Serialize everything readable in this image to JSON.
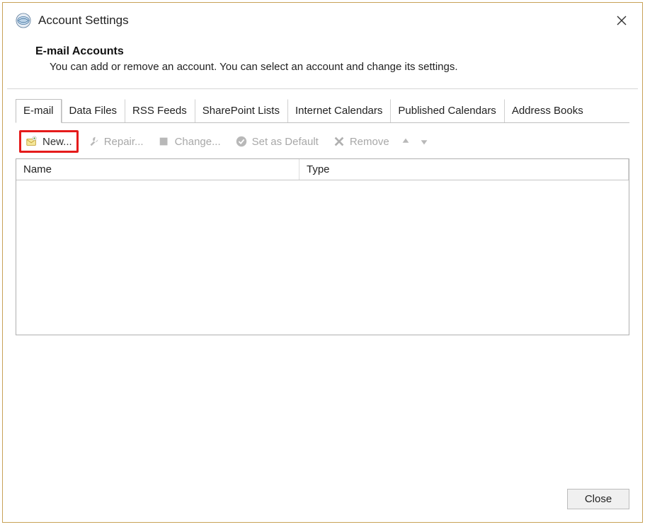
{
  "window": {
    "title": "Account Settings"
  },
  "header": {
    "title": "E-mail Accounts",
    "description": "You can add or remove an account. You can select an account and change its settings."
  },
  "tabs": [
    {
      "label": "E-mail",
      "active": true
    },
    {
      "label": "Data Files",
      "active": false
    },
    {
      "label": "RSS Feeds",
      "active": false
    },
    {
      "label": "SharePoint Lists",
      "active": false
    },
    {
      "label": "Internet Calendars",
      "active": false
    },
    {
      "label": "Published Calendars",
      "active": false
    },
    {
      "label": "Address Books",
      "active": false
    }
  ],
  "toolbar": {
    "new_label": "New...",
    "repair_label": "Repair...",
    "change_label": "Change...",
    "set_default_label": "Set as Default",
    "remove_label": "Remove"
  },
  "columns": {
    "name": "Name",
    "type": "Type"
  },
  "footer": {
    "close_label": "Close"
  }
}
